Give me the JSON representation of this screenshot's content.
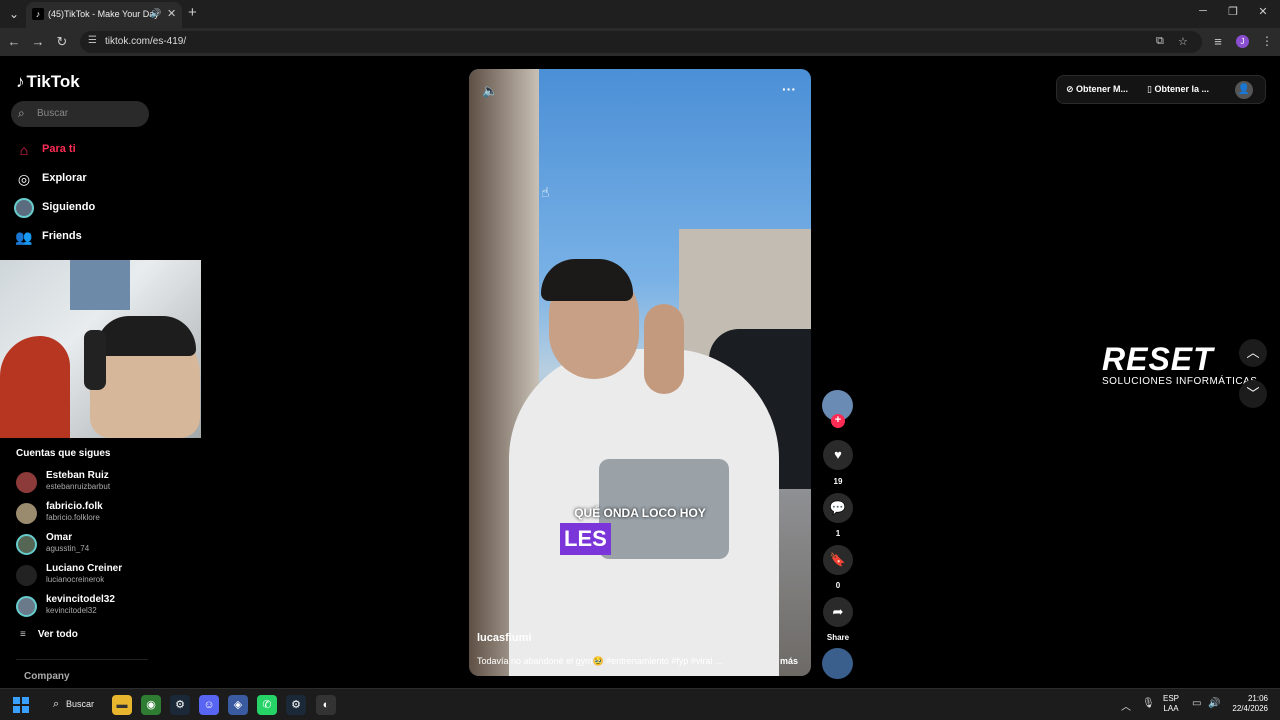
{
  "browser": {
    "tab_title": "(45)TikTok - Make Your Day",
    "url": "tiktok.com/es-419/"
  },
  "sidebar": {
    "logo": "TikTok",
    "search_placeholder": "Buscar",
    "nav": [
      {
        "label": "Para ti",
        "icon": "home-icon",
        "active": true
      },
      {
        "label": "Explorar",
        "icon": "compass-icon"
      },
      {
        "label": "Siguiendo",
        "icon": "avatar-icon"
      },
      {
        "label": "Friends",
        "icon": "friends-icon"
      }
    ],
    "following_title": "Cuentas que sigues",
    "accounts": [
      {
        "name": "Esteban Ruiz",
        "handle": "estebanruizbarbut"
      },
      {
        "name": "fabricio.folk",
        "handle": "fabricio.folklore"
      },
      {
        "name": "Omar",
        "handle": "agusstin_74"
      },
      {
        "name": "Luciano Creiner",
        "handle": "lucianocreinerok"
      },
      {
        "name": "kevincitodel32",
        "handle": "kevincitodel32"
      }
    ],
    "see_all": "Ver todo",
    "company": "Company"
  },
  "video": {
    "caption_line1": "QUÉ ONDA LOCO HOY",
    "caption_line2": "LES",
    "author": "lucasfiumi",
    "description": "Todavía no abandoné el gym🥹 #entrenamiento #fyp #viral ...",
    "more": "más"
  },
  "actions": {
    "likes": "19",
    "comments": "1",
    "saves": "0",
    "share_label": "Share"
  },
  "topright": {
    "coins": "Obtener M...",
    "app": "Obtener la ..."
  },
  "watermark": {
    "brand": "RESET",
    "tagline": "SOLUCIONES INFORMÁTICAS"
  },
  "taskbar": {
    "search": "Buscar",
    "lang_top": "ESP",
    "lang_bottom": "LAA",
    "time": "21:06",
    "date": "22/4/2026"
  },
  "colors": {
    "accent": "#fe2c55",
    "caption_highlight": "#7a36d8"
  }
}
